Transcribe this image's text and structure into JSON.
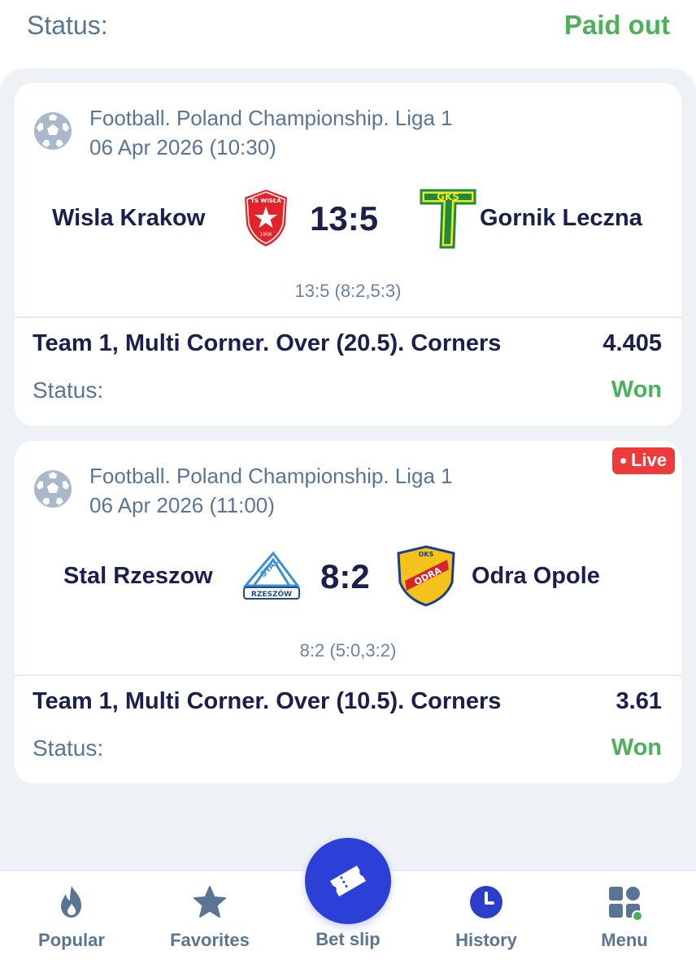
{
  "header": {
    "status_label": "Status:",
    "status_value": "Paid out"
  },
  "colors": {
    "accent": "#2c3fd6",
    "won": "#4cb15a",
    "live": "#ee3a3a",
    "muted": "#5a7594",
    "dark": "#1a1f4b"
  },
  "events": [
    {
      "league": "Football. Poland Championship. Liga 1",
      "datetime": "06 Apr 2026 (10:30)",
      "live": false,
      "team1": "Wisla Krakow",
      "team2": "Gornik Leczna",
      "team1_logo_text": "TS WISŁA",
      "team1_logo_year": "1906",
      "team2_logo_text": "GKS",
      "score": "13:5",
      "periods": "13:5 (8:2,5:3)",
      "bet": "Team 1, Multi Corner. Over (20.5). Corners",
      "coef": "4.405",
      "status_label": "Status:",
      "status": "Won"
    },
    {
      "league": "Football. Poland Championship. Liga 1",
      "datetime": "06 Apr 2026 (11:00)",
      "live": true,
      "live_label": "Live",
      "team1": "Stal Rzeszow",
      "team2": "Odra Opole",
      "team1_logo_text": "STAL",
      "team1_logo_sub": "RZESZÓW",
      "team2_logo_text": "ODRA",
      "team2_logo_top": "OKS",
      "score": "8:2",
      "periods": "8:2 (5:0,3:2)",
      "bet": "Team 1, Multi Corner. Over (10.5). Corners",
      "coef": "3.61",
      "status_label": "Status:",
      "status": "Won"
    }
  ],
  "tabbar": {
    "items": [
      {
        "label": "Popular",
        "icon": "flame-icon"
      },
      {
        "label": "Favorites",
        "icon": "star-icon"
      },
      {
        "label": "Bet slip",
        "icon": "ticket-icon"
      },
      {
        "label": "History",
        "icon": "clock-icon",
        "active": true
      },
      {
        "label": "Menu",
        "icon": "menu-grid-icon"
      }
    ]
  }
}
